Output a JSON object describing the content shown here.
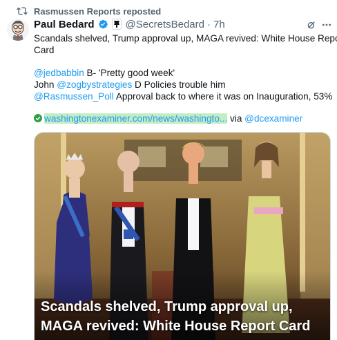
{
  "repost": {
    "label": "Rasmussen Reports reposted"
  },
  "author": {
    "name": "Paul Bedard",
    "handle": "@SecretsBedard",
    "time": "7h"
  },
  "tweet": {
    "line1": "Scandals shelved, Trump approval up, MAGA revived: White House Report",
    "line2": "Card",
    "l3_mention": "@jedbabbin",
    "l3_rest": " B- 'Pretty good week'",
    "l4_pre": "John ",
    "l4_mention": "@zogbystrategies",
    "l4_rest": " D Policies trouble him",
    "l5_mention": "@Rasmussen_Poll",
    "l5_rest": " Approval back to where it was on Inauguration, 53%",
    "url": "washingtonexaminer.com/news/washingto...",
    "via": " via ",
    "via_mention": "@dcexaminer"
  },
  "media": {
    "headline_l1": "Scandals shelved, Trump approval up,",
    "headline_l2": "MAGA revived: White House Report Card"
  },
  "colors": {
    "link": "#1d9bf0",
    "muted": "#536471",
    "url_highlight": "#c4ecc4",
    "verified": "#1d9bf0"
  },
  "icons": [
    "repost-icon",
    "verified-icon",
    "affiliate-badge-icon",
    "grok-icon",
    "more-icon",
    "check-icon"
  ]
}
